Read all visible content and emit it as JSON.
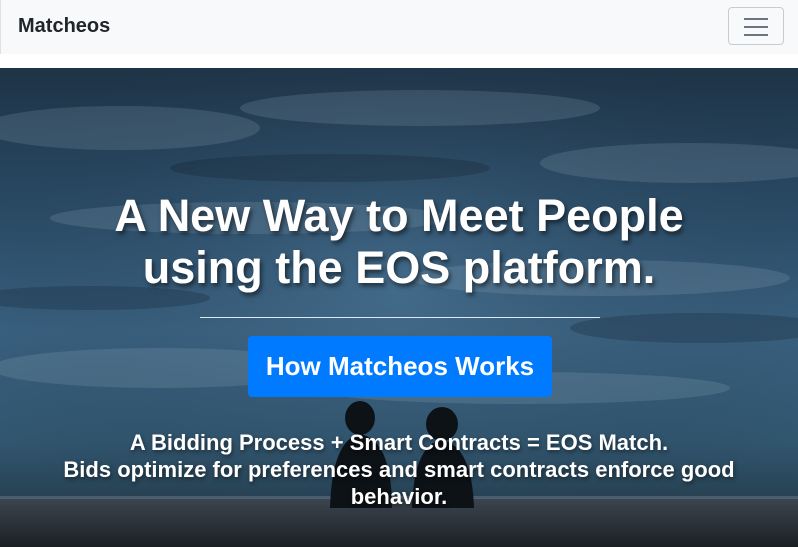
{
  "navbar": {
    "brand": "Matcheos",
    "toggler_icon": "hamburger-menu-icon"
  },
  "hero": {
    "headline_line1": "A New Way to Meet People",
    "headline_line2": "using the EOS platform.",
    "cta_label": "How Matcheos Works",
    "tagline_line1": "A Bidding Process + Smart Contracts = EOS Match.",
    "tagline_line2": "Bids optimize for preferences and smart contracts enforce good behavior."
  },
  "colors": {
    "navbar_bg": "#f8f9fa",
    "brand_text": "#212529",
    "cta_bg": "#007bff",
    "hero_text": "#ffffff"
  }
}
